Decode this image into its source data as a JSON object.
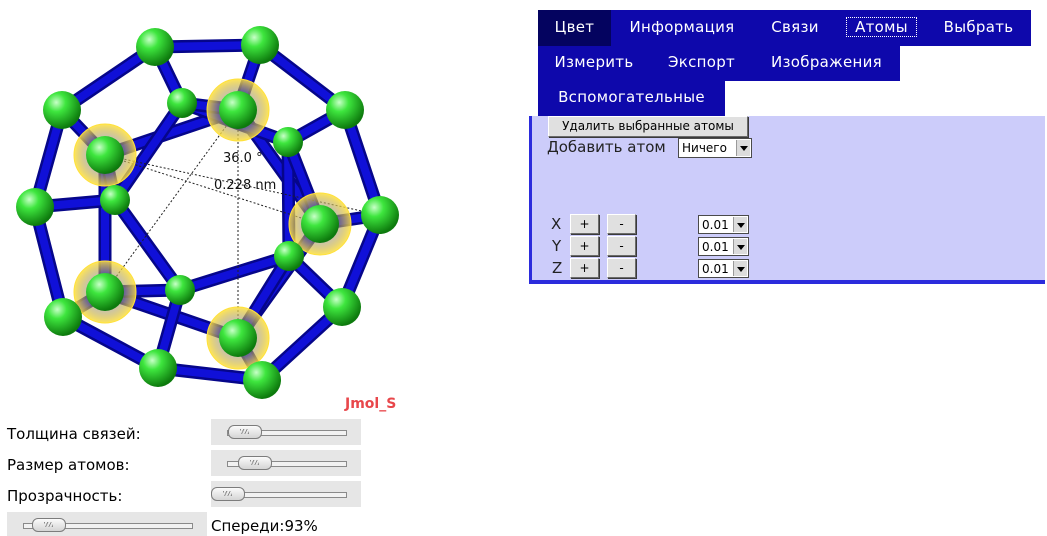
{
  "viewer": {
    "app_label": "Jmol_S",
    "angle_label": "36.0 °",
    "distance_label": "0.228 nm"
  },
  "controls": {
    "bond_thickness": {
      "label": "Толщина связей:",
      "level": 0.15
    },
    "atom_size": {
      "label": "Размер атомов:",
      "level": 0.24
    },
    "transparency": {
      "label": "Прозрачность:",
      "level": 0.0
    },
    "front_slice": {
      "label": "Спереди:",
      "value": "93%",
      "level": 0.15
    }
  },
  "menu": {
    "items": [
      {
        "label": "Цвет",
        "active": true
      },
      {
        "label": "Информация"
      },
      {
        "label": "Связи"
      },
      {
        "label": "Атомы",
        "focused": true
      },
      {
        "label": "Выбрать"
      },
      {
        "label": "Измерить"
      },
      {
        "label": "Экспорт"
      },
      {
        "label": "Изображения"
      },
      {
        "label": "Вспомогательные"
      }
    ]
  },
  "panel": {
    "delete_button": "Удалить выбранные атомы",
    "add_atom_label": "Добавить атом",
    "add_atom_value": "Ничего",
    "axes": [
      {
        "axis": "X",
        "plus": "+",
        "minus": "-",
        "step": "0.01"
      },
      {
        "axis": "Y",
        "plus": "+",
        "minus": "-",
        "step": "0.01"
      },
      {
        "axis": "Z",
        "plus": "+",
        "minus": "-",
        "step": "0.01"
      }
    ]
  },
  "colors": {
    "menu_bg": "#0e08ab",
    "menu_active": "#04035f",
    "panel_bg": "#ccccfa",
    "bond": "#1010d8",
    "atom": "#22cc22",
    "selection_halo": "#ffe13a",
    "label_red": "#e8474b"
  }
}
